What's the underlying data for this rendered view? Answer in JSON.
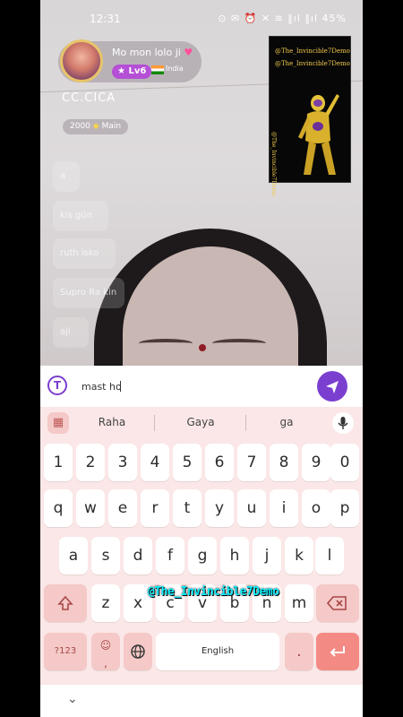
{
  "status_bar": {
    "time": "12:31",
    "icons": "⊙ ✉ ⏰ ✕ ≋ ‖ıl ‖ıl",
    "battery": "45%"
  },
  "host": {
    "name": "Mo mon lolo ji",
    "level": "Lv6",
    "country": "India",
    "id": "CC.CICA",
    "coins": "2000",
    "coins_suffix": "Main"
  },
  "comments": [
    "a",
    "kis gün",
    "ruth isko",
    "Supro Ra kin",
    "aji"
  ],
  "overlay_card": {
    "line1": "@The_Invincible7Demo",
    "line2": "@The_Invincible7Demo",
    "vertical": "@The_Invincible7Demo"
  },
  "input": {
    "value": "mast ho",
    "send_icon": "paper-plane-icon",
    "logo": "T"
  },
  "keyboard": {
    "suggestions": [
      "Raha",
      "Gaya",
      "ga"
    ],
    "number_row": [
      "1",
      "2",
      "3",
      "4",
      "5",
      "6",
      "7",
      "8",
      "9",
      "0"
    ],
    "row1": [
      "q",
      "w",
      "e",
      "r",
      "t",
      "y",
      "u",
      "i",
      "o",
      "p"
    ],
    "row2": [
      "a",
      "s",
      "d",
      "f",
      "g",
      "h",
      "j",
      "k",
      "l"
    ],
    "row3": [
      "z",
      "x",
      "c",
      "v",
      "b",
      "n",
      "m"
    ],
    "symbols_key": "?123",
    "emoji_key": "☺",
    "globe_key": "globe-icon",
    "space_label": "English",
    "comma": ",",
    "period": ".",
    "shift_icon": "shift-icon",
    "backspace_icon": "backspace-icon",
    "enter_icon": "enter-icon"
  },
  "watermark": "@The_Invincible7Demo",
  "colors": {
    "accent": "#7b3fd0",
    "keyboard_bg": "#fbe7e7",
    "action_key": "#f38a84",
    "watermark": "#0ff0ff"
  }
}
